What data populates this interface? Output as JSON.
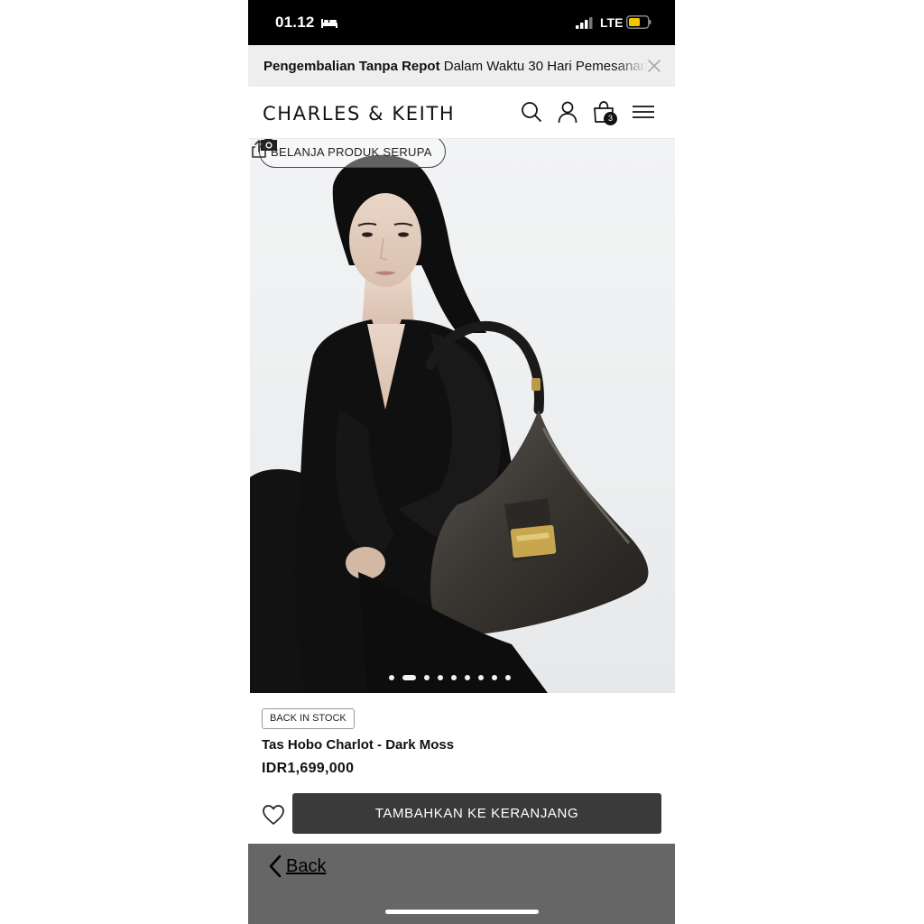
{
  "status_bar": {
    "time": "01.12",
    "network": "LTE",
    "sleep_icon": "bed-icon",
    "signal_icon": "signal-bars-icon",
    "battery_icon": "battery-low-icon",
    "battery_color": "#f5c400"
  },
  "announcement": {
    "bold_text": "Pengembalian Tanpa Repot",
    "text": " Dalam Waktu 30 Hari Pemesanan",
    "close_icon": "close-icon"
  },
  "header": {
    "brand": "CHARLES & KEITH",
    "cart_count": "3",
    "icons": [
      "search-icon",
      "account-icon",
      "shopping-bag-icon",
      "hamburger-menu-icon"
    ]
  },
  "hero": {
    "similar_button_label": "BELANJA PRODUK SERUPA",
    "camera_icon": "camera-icon",
    "share_icon": "share-icon",
    "carousel_total": 9,
    "carousel_active_index": 1
  },
  "product": {
    "badge": "BACK IN STOCK",
    "name": "Tas Hobo Charlot - Dark Moss",
    "price": "IDR1,699,000",
    "add_to_cart_label": "TAMBAHKAN KE KERANJANG",
    "wishlist_icon": "heart-outline-icon",
    "button_color": "#3a3a3a"
  },
  "browser": {
    "back_label": "Back",
    "back_icon": "chevron-left-icon",
    "bar_color": "#666666"
  }
}
